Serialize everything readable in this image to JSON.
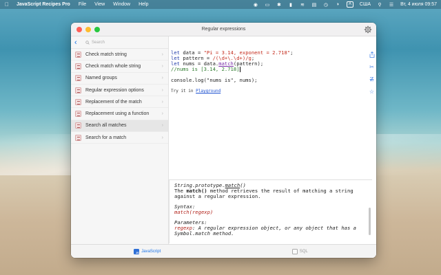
{
  "menubar": {
    "app_name": "JavaScript Recipes Pro",
    "items": [
      "File",
      "View",
      "Window",
      "Help"
    ],
    "input_source": "США",
    "clock": "Вт, 4 июля 09:57"
  },
  "window": {
    "title": "Regular expressions"
  },
  "sidebar": {
    "search_placeholder": "Search",
    "items": [
      {
        "label": "Check match string",
        "selected": false
      },
      {
        "label": "Check match whole string",
        "selected": false
      },
      {
        "label": "Named groups",
        "selected": false
      },
      {
        "label": "Regular expression options",
        "selected": false
      },
      {
        "label": "Replacement of the match",
        "selected": false
      },
      {
        "label": "Replacement using a function",
        "selected": false
      },
      {
        "label": "Search all matches",
        "selected": true
      },
      {
        "label": "Search for a match",
        "selected": false
      }
    ]
  },
  "editor": {
    "line1": {
      "a": "let ",
      "b": "data",
      "c": " = ",
      "d": "\"Pi = 3.14, exponent = 2.718\"",
      "e": ";"
    },
    "line2": {
      "a": "let ",
      "b": "pattern",
      "c": " = ",
      "d": "/(\\d+\\.\\d+)/g",
      "e": ";"
    },
    "line3": {
      "a": "let ",
      "b": "nums",
      "c": " = data.",
      "d": "match",
      "e": "(pattern);"
    },
    "line4": "//nums is [3.14, 2.718]",
    "line5": "console.log(\"nums is\", nums);",
    "try_prefix": "Try it in ",
    "try_link": "Playground"
  },
  "doc": {
    "sig_prefix": "String.prototype.",
    "sig_name": "match",
    "sig_suffix": "()",
    "desc_prefix": "The ",
    "desc_bold": "match()",
    "desc_rest": " method retrieves the result of matching a string",
    "desc_line2": "against a regular expression.",
    "syntax_label": "Syntax:",
    "syntax_value": "match(regexp)",
    "params_label": "Parameters:",
    "param_name": "regexp",
    "param_desc": ": A regular expression object, or any object that has a",
    "param_desc2": "Symbol.match method."
  },
  "tabs": [
    {
      "label": "JavaScript",
      "active": true
    },
    {
      "label": "SQL",
      "active": false
    }
  ],
  "icons": {
    "menubar": [
      "apple-icon",
      "record-icon",
      "wifi-icon",
      "bluetooth-icon",
      "control-center-icon"
    ],
    "rail": [
      "share-icon",
      "scissors-icon",
      "strikethrough-icon",
      "star-icon"
    ]
  },
  "colors": {
    "accent": "#1a73e8",
    "string": "#c42b1c",
    "keyword": "#1f3aa8",
    "comment": "#2c7a2c"
  }
}
